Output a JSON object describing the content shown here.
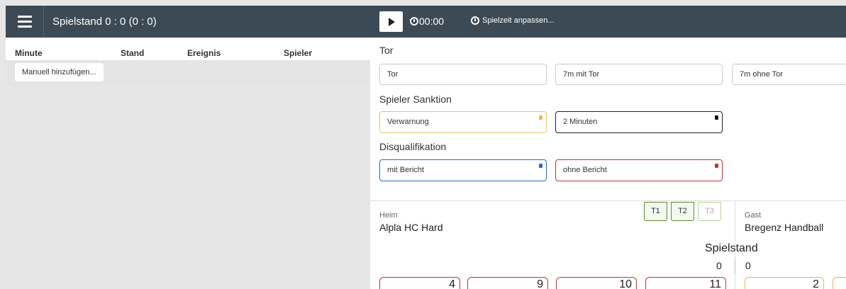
{
  "header": {
    "title": "Spielstand 0 : 0 (0 : 0)",
    "clock": "00:00",
    "adjust_label": "Spielzeit anpassen..."
  },
  "table": {
    "columns": [
      "Minute",
      "Stand",
      "Ereignis",
      "Spieler"
    ],
    "manual_add_label": "Manuell hinzufügen..."
  },
  "events": {
    "tor_label": "Tor",
    "tor_buttons": [
      "Tor",
      "7m mit Tor",
      "7m ohne Tor"
    ],
    "sanktion_label": "Spieler Sanktion",
    "sanktion_buttons": [
      "Verwarnung",
      "2 Minuten"
    ],
    "disq_label": "Disqualifikation",
    "disq_buttons": [
      "mit Bericht",
      "ohne Bericht"
    ]
  },
  "teams": {
    "home_label": "Heim",
    "home_name": "Alpla HC Hard",
    "away_label": "Gast",
    "away_name": "Bregenz Handball",
    "timeouts": [
      "T1",
      "T2",
      "T3"
    ],
    "spielstand_label": "Spielstand",
    "home_score": "0",
    "away_score": "0",
    "home_players": [
      "4",
      "9",
      "10",
      "11"
    ],
    "away_players": [
      "2"
    ]
  },
  "colors": {
    "topbar": "#3b4a55",
    "warning": "#e8b94f",
    "blue": "#2d6fb8",
    "red": "#b5393f",
    "green": "#5b8a2f"
  }
}
